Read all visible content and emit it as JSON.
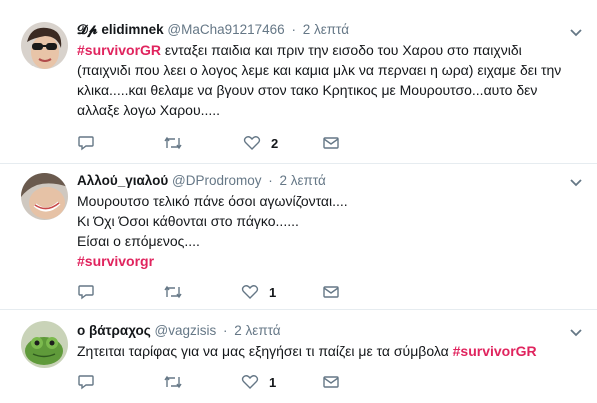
{
  "colors": {
    "hashtag": "#e0245e",
    "muted": "#657786",
    "divider": "#e6ecf0"
  },
  "tweets": [
    {
      "display_name": "𝓓𝓹 elidimnek",
      "handle": "@MaCha91217466",
      "separator": "·",
      "time": "2 λεπτά",
      "lines": [
        {
          "hashtag": "#survivorGR",
          "text": " ενταξει παιδια και πριν την εισοδο του Χαρου στο παιχνιδι"
        },
        {
          "hashtag": "",
          "text": "(παιχνιδι που λεει ο λογος λεμε και καμια μλκ να περναει η ωρα)  ειχαμε δει την"
        },
        {
          "hashtag": "",
          "text": "κλικα.....και θελαμε να βγουν στον τακο Κρητικος με Μουρουτσο...αυτο δεν"
        },
        {
          "hashtag": "",
          "text": "αλλαξε λογω Χαρου....."
        }
      ],
      "reply_icon": "reply-icon",
      "retweet_icon": "retweet-icon",
      "like_icon": "heart-icon",
      "like_count": "2",
      "mail_icon": "envelope-icon"
    },
    {
      "display_name": "Αλλού_γιαλού",
      "handle": "@DProdromoy",
      "separator": "·",
      "time": "2 λεπτά",
      "lines": [
        {
          "hashtag": "",
          "text": "Μουρουτσο τελικό πάνε όσοι αγωνίζονται...."
        },
        {
          "hashtag": "",
          "text": "Κι Όχι Όσοι κάθονται στο πάγκο......"
        },
        {
          "hashtag": "",
          "text": "Είσαι ο επόμενος...."
        },
        {
          "hashtag": "#survivorgr",
          "text": ""
        }
      ],
      "reply_icon": "reply-icon",
      "retweet_icon": "retweet-icon",
      "like_icon": "heart-icon",
      "like_count": "1",
      "mail_icon": "envelope-icon"
    },
    {
      "display_name": "ο βάτραχος",
      "handle": "@vagzisis",
      "separator": "·",
      "time": "2 λεπτά",
      "lines": [
        {
          "hashtag": "",
          "text": "Ζητειται ταρίφας για να μας εξηγήσει τι παίζει με τα σύμβολα ",
          "trailing_hashtag": "#survivorGR"
        }
      ],
      "reply_icon": "reply-icon",
      "retweet_icon": "retweet-icon",
      "like_icon": "heart-icon",
      "like_count": "1",
      "mail_icon": "envelope-icon"
    }
  ]
}
